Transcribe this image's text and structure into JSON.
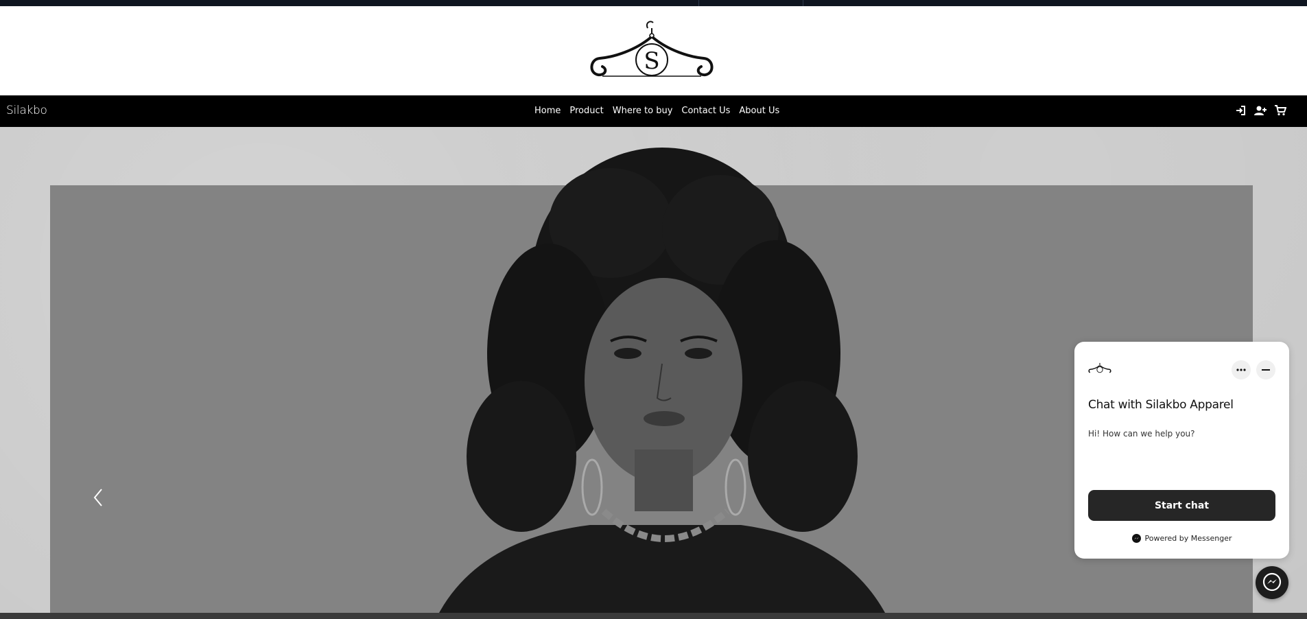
{
  "brand": {
    "name": "Silakbo",
    "logo_letter": "S"
  },
  "nav": {
    "links": [
      "Home",
      "Product",
      "Where to buy",
      "Contact Us",
      "About Us"
    ],
    "icons": [
      "sign-in-icon",
      "user-plus-icon",
      "cart-icon"
    ]
  },
  "hero": {
    "carousel_prev_icon": "chevron-left-icon"
  },
  "chat": {
    "title": "Chat with Silakbo Apparel",
    "message": "Hi! How can we help you?",
    "start_button": "Start chat",
    "powered_by": "Powered by Messenger"
  },
  "colors": {
    "nav_bg": "#000000",
    "button_bg": "#262626",
    "hero_bg": "#c8c8c8"
  }
}
